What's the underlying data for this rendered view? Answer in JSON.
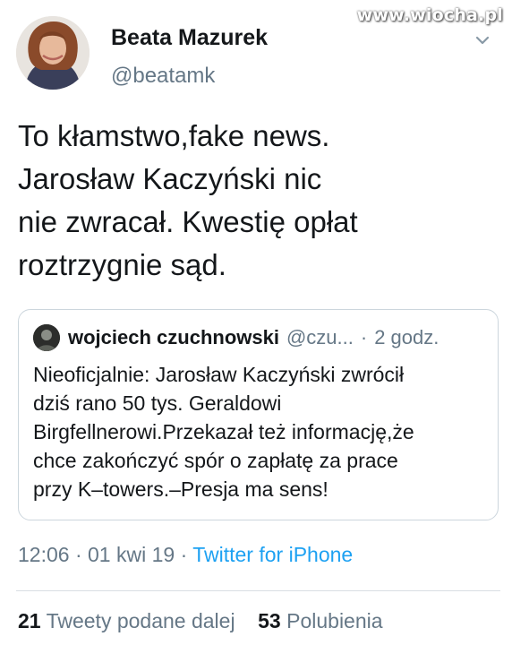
{
  "watermark": "www.wiocha.pl",
  "author": {
    "display_name": "Beata Mazurek",
    "handle": "@beatamk"
  },
  "tweet": {
    "text": "To kłamstwo,fake news.\nJarosław Kaczyński nic\nnie zwracał. Kwestię opłat\nroztrzygnie sąd."
  },
  "quoted": {
    "name": "wojciech czuchnowski",
    "handle": "@czu...",
    "separator": "·",
    "time": "2 godz.",
    "text": "Nieoficjalnie: Jarosław Kaczyński zwrócił\ndziś rano 50 tys. Geraldowi\nBirgfellnerowi.Przekazał też informację,że\nchce zakończyć spór o zapłatę za prace\nprzy K–towers.–Presja ma sens!"
  },
  "meta": {
    "time": "12:06",
    "date": "01 kwi 19",
    "separator": "·",
    "source": "Twitter for iPhone"
  },
  "stats": {
    "retweets_count": "21",
    "retweets_label": "Tweety podane dalej",
    "likes_count": "53",
    "likes_label": "Polubienia"
  },
  "icons": {
    "menu": "chevron-down-icon"
  },
  "colors": {
    "link": "#1da1f2",
    "secondary_text": "#657786",
    "border": "#ccd6dd"
  }
}
